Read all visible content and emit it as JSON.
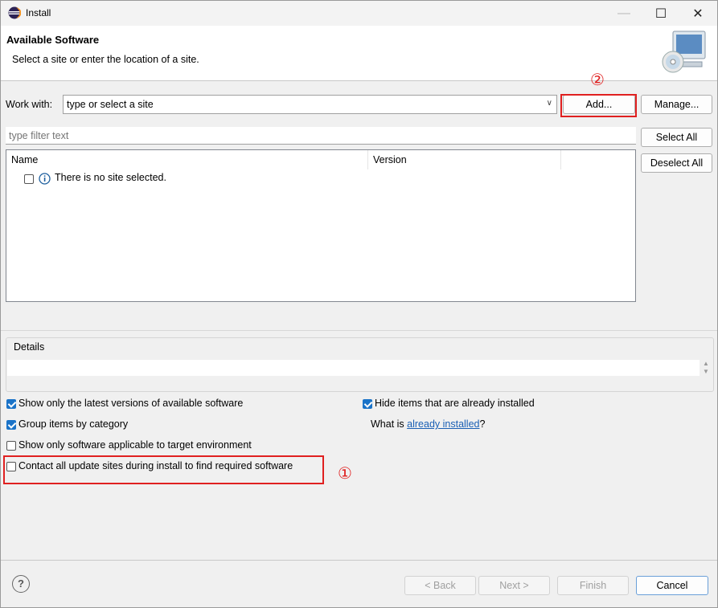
{
  "window": {
    "title": "Install",
    "controls": {
      "minimize": "—",
      "maximize": "☐",
      "close": "✕"
    }
  },
  "header": {
    "title": "Available Software",
    "description": "Select a site or enter the location of a site."
  },
  "work_with": {
    "label": "Work with:",
    "value": "type or select a site",
    "add_label": "Add...",
    "manage_label": "Manage..."
  },
  "filter": {
    "placeholder": "type filter text"
  },
  "selection_buttons": {
    "select_all": "Select All",
    "deselect_all": "Deselect All"
  },
  "tree": {
    "columns": [
      "Name",
      "Version"
    ],
    "rows": [
      {
        "text": "There is no site selected."
      }
    ]
  },
  "details": {
    "label": "Details"
  },
  "options": {
    "latest_versions": {
      "label": "Show only the latest versions of available software",
      "checked": true
    },
    "group_by_category": {
      "label": "Group items by category",
      "checked": true
    },
    "target_environment": {
      "label": "Show only software applicable to target environment",
      "checked": false
    },
    "contact_all_sites": {
      "label": "Contact all update sites during install to find required software",
      "checked": false
    },
    "hide_installed": {
      "label": "Hide items that are already installed",
      "checked": true
    },
    "what_is_prefix": "What is ",
    "what_is_link": "already installed",
    "what_is_suffix": "?"
  },
  "annotations": {
    "marker1": "①",
    "marker2": "②",
    "color": "#e02020"
  },
  "footer": {
    "help_icon": "?",
    "back": "< Back",
    "next": "Next >",
    "finish": "Finish",
    "cancel": "Cancel"
  }
}
